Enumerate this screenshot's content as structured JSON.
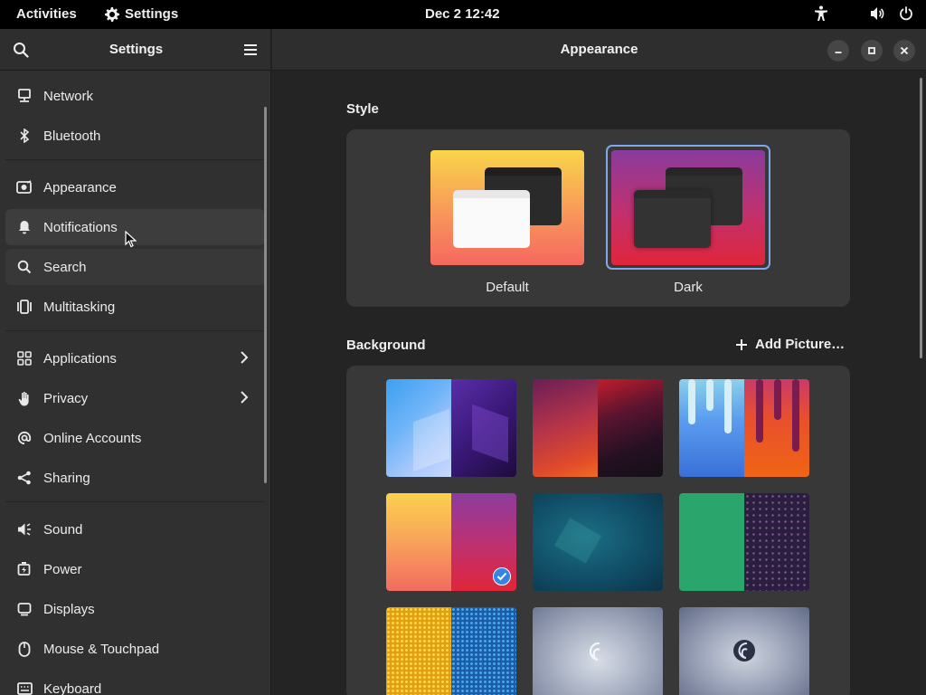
{
  "topbar": {
    "activities": "Activities",
    "app_name": "Settings",
    "clock": "Dec 2  12:42"
  },
  "sidebar": {
    "title": "Settings",
    "items": [
      {
        "label": "Network",
        "icon": "network-icon"
      },
      {
        "label": "Bluetooth",
        "icon": "bluetooth-icon"
      },
      {
        "label": "Appearance",
        "icon": "appearance-icon"
      },
      {
        "label": "Notifications",
        "icon": "bell-icon"
      },
      {
        "label": "Search",
        "icon": "search-icon"
      },
      {
        "label": "Multitasking",
        "icon": "multitasking-icon"
      },
      {
        "label": "Applications",
        "icon": "applications-icon"
      },
      {
        "label": "Privacy",
        "icon": "hand-icon"
      },
      {
        "label": "Online Accounts",
        "icon": "at-icon"
      },
      {
        "label": "Sharing",
        "icon": "share-icon"
      },
      {
        "label": "Sound",
        "icon": "speaker-icon"
      },
      {
        "label": "Power",
        "icon": "power-battery-icon"
      },
      {
        "label": "Displays",
        "icon": "display-icon"
      },
      {
        "label": "Mouse & Touchpad",
        "icon": "mouse-icon"
      },
      {
        "label": "Keyboard",
        "icon": "keyboard-icon"
      }
    ]
  },
  "main": {
    "title": "Appearance",
    "style": {
      "section_title": "Style",
      "options": [
        {
          "label": "Default",
          "selected": false
        },
        {
          "label": "Dark",
          "selected": true
        }
      ]
    },
    "background": {
      "section_title": "Background",
      "add_picture": "Add Picture…",
      "selected_index": 3
    }
  },
  "colors": {
    "accent": "#3584e4",
    "window_bg": "#242424",
    "sidebar_bg": "#303030",
    "card_bg": "#383838"
  }
}
